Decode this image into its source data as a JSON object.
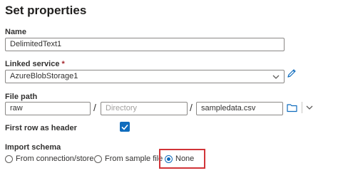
{
  "panel": {
    "title": "Set properties"
  },
  "name": {
    "label": "Name",
    "value": "DelimitedText1"
  },
  "linked_service": {
    "label": "Linked service",
    "required_mark": "*",
    "value": "AzureBlobStorage1"
  },
  "file_path": {
    "label": "File path",
    "container": "raw",
    "separator": "/",
    "directory_placeholder": "Directory",
    "file": "sampledata.csv"
  },
  "first_row_header": {
    "label": "First row as header",
    "checked": true
  },
  "import_schema": {
    "label": "Import schema",
    "options": [
      "From connection/store",
      "From sample file",
      "None"
    ],
    "selected": "None"
  },
  "colors": {
    "accent": "#0f6cbd",
    "highlight": "#d13438"
  }
}
